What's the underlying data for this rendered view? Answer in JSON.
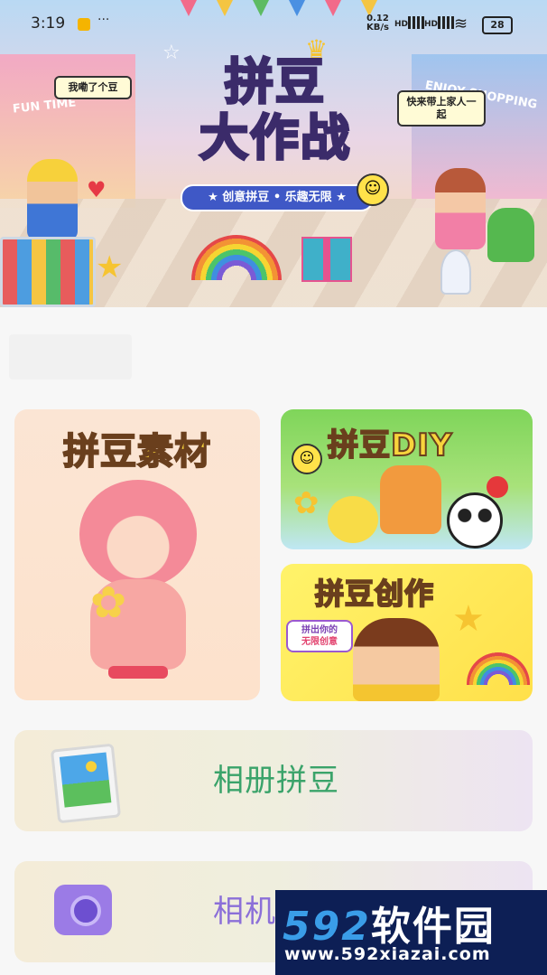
{
  "status_bar": {
    "time": "3:19",
    "more": "···",
    "net_speed_value": "0.12",
    "net_speed_unit": "KB/s",
    "sig1": "HD",
    "sig2": "HD",
    "battery": "28"
  },
  "banner": {
    "title_line1": "拼豆",
    "title_line2": "大作战",
    "slogan": "★ 创意拼豆 • 乐趣无限 ★",
    "bubble_left": "我嘞了个豆",
    "bubble_right": "快来带上家人一起",
    "sign_left": "FUN TIME",
    "sign_right": "ENJOY SHOPPING"
  },
  "cards": {
    "materials": {
      "title": "拼豆素材"
    },
    "diy": {
      "title": "拼豆DIY"
    },
    "create": {
      "title": "拼豆创作",
      "badge_pre": "拼出你的",
      "badge_em": "无限创意"
    }
  },
  "actions": {
    "album": {
      "label": "相册拼豆",
      "icon": "photo-album-icon"
    },
    "camera": {
      "label": "相机拼豆",
      "icon": "camera-icon"
    }
  },
  "watermark": {
    "brand_num": "592",
    "brand_cn": "软件园",
    "url": "www.592xiazai.com"
  }
}
